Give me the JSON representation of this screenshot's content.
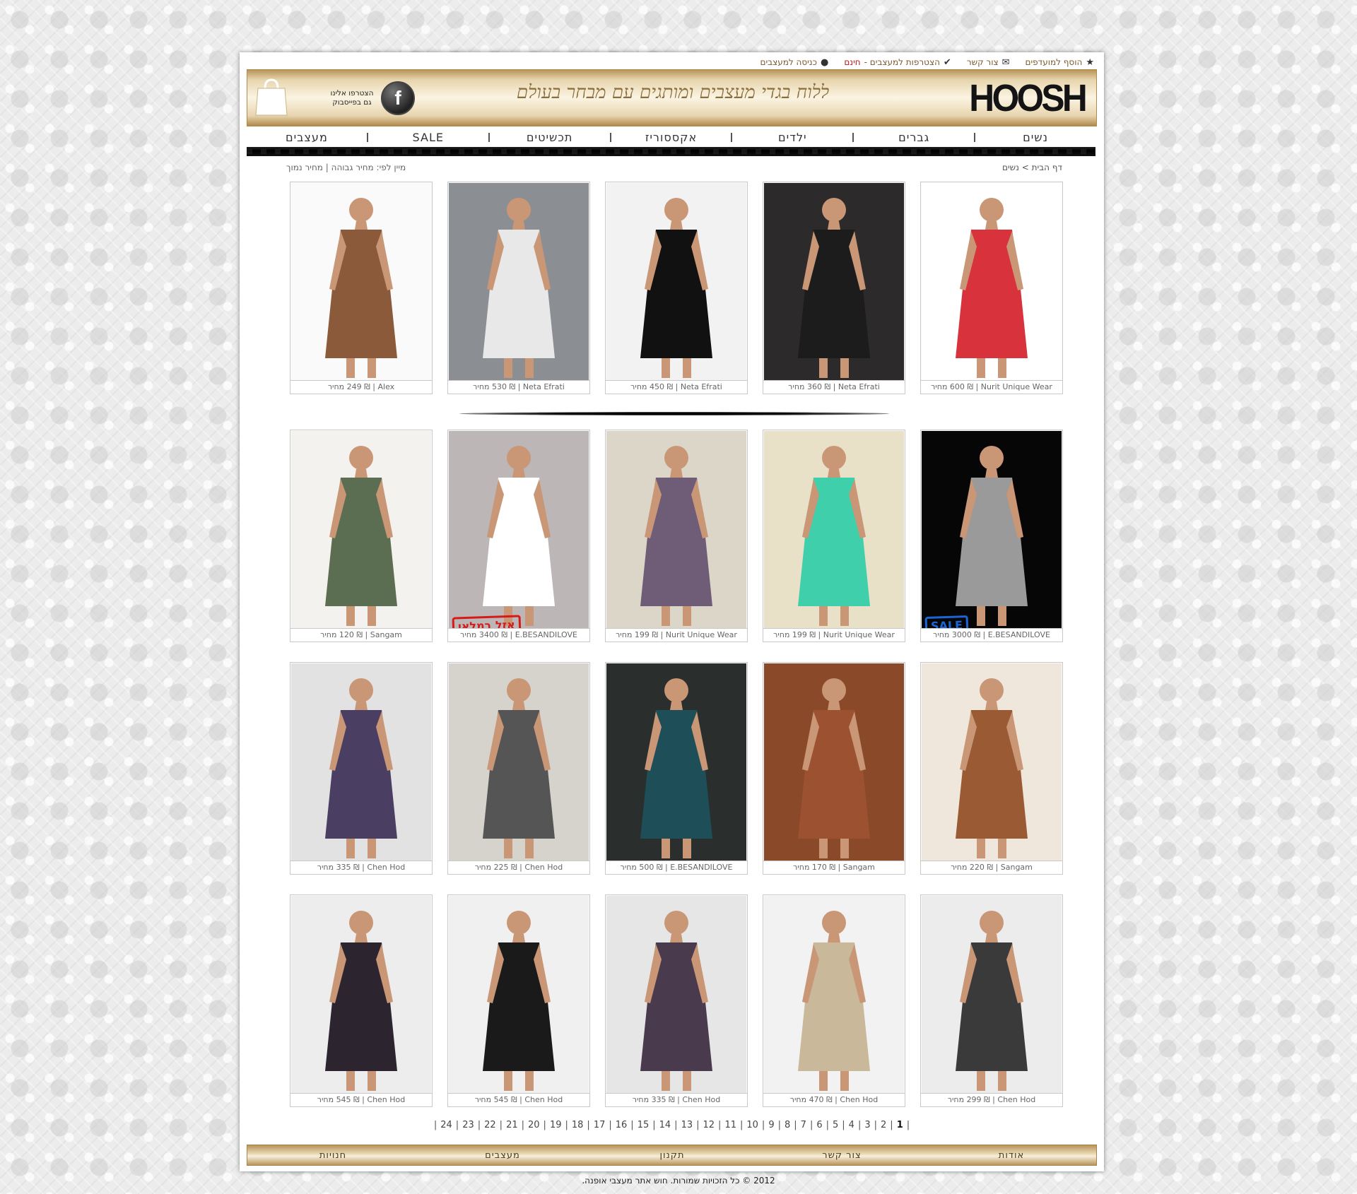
{
  "toplinks": {
    "favorites": "הוסף למועדפים",
    "contact": "צור קשר",
    "join": "הצטרפות למעצבים - ",
    "join_free": "חינם",
    "login": "כניסה למעצבים"
  },
  "header": {
    "logo": "HOOSH",
    "slogan": "ללוח בגדי מעצבים ומותגים עם מבחר בעולם",
    "facebook_text": "הצטרפו אלינו גם בפייסבוק"
  },
  "nav": [
    "נשים",
    "גברים",
    "ילדים",
    "אקססוריז",
    "תכשיטים",
    "SALE",
    "מעצבים"
  ],
  "breadcrumb": {
    "home": "דף הבית",
    "sep": " > ",
    "current": "נשים"
  },
  "sort": {
    "label": "מיין לפי:",
    "high": "מחיר גבוהה",
    "sep": " | ",
    "low": "מחיר נמוך"
  },
  "products": [
    {
      "designer": "Nurit Unique Wear",
      "price": "600"
    },
    {
      "designer": "Neta Efrati",
      "price": "360"
    },
    {
      "designer": "Neta Efrati",
      "price": "450"
    },
    {
      "designer": "Neta Efrati",
      "price": "530"
    },
    {
      "designer": "Alex",
      "price": "249"
    },
    {
      "designer": "E.BESANDILOVE",
      "price": "3000",
      "badge": "SALE"
    },
    {
      "designer": "Nurit Unique Wear",
      "price": "199"
    },
    {
      "designer": "Nurit Unique Wear",
      "price": "199"
    },
    {
      "designer": "E.BESANDILOVE",
      "price": "3400",
      "badge": "אזל במלאי"
    },
    {
      "designer": "Sangam",
      "price": "120"
    },
    {
      "designer": "Sangam",
      "price": "220"
    },
    {
      "designer": "Sangam",
      "price": "170"
    },
    {
      "designer": "E.BESANDILOVE",
      "price": "500"
    },
    {
      "designer": "Chen Hod",
      "price": "225"
    },
    {
      "designer": "Chen Hod",
      "price": "335"
    },
    {
      "designer": "Chen Hod",
      "price": "299"
    },
    {
      "designer": "Chen Hod",
      "price": "470"
    },
    {
      "designer": "Chen Hod",
      "price": "335"
    },
    {
      "designer": "Chen Hod",
      "price": "545"
    },
    {
      "designer": "Chen Hod",
      "price": "545"
    }
  ],
  "price_label": "מחיר",
  "currency": "₪",
  "pager": [
    "1",
    "2",
    "3",
    "4",
    "5",
    "6",
    "7",
    "8",
    "9",
    "10",
    "11",
    "12",
    "13",
    "14",
    "15",
    "16",
    "17",
    "18",
    "19",
    "20",
    "21",
    "22",
    "23",
    "24"
  ],
  "footer": [
    "אודות",
    "צור קשר",
    "תקנון",
    "מעצבים",
    "חנויות"
  ],
  "copyright": "2012 © כל הזכויות שמורות. חוש אתר מעצבי אופנה.",
  "colors": {
    "gold": "#c8a46a",
    "free": "#c0181e",
    "sale_badge": "#1a66d6",
    "soldout_badge": "#d61a1a"
  }
}
